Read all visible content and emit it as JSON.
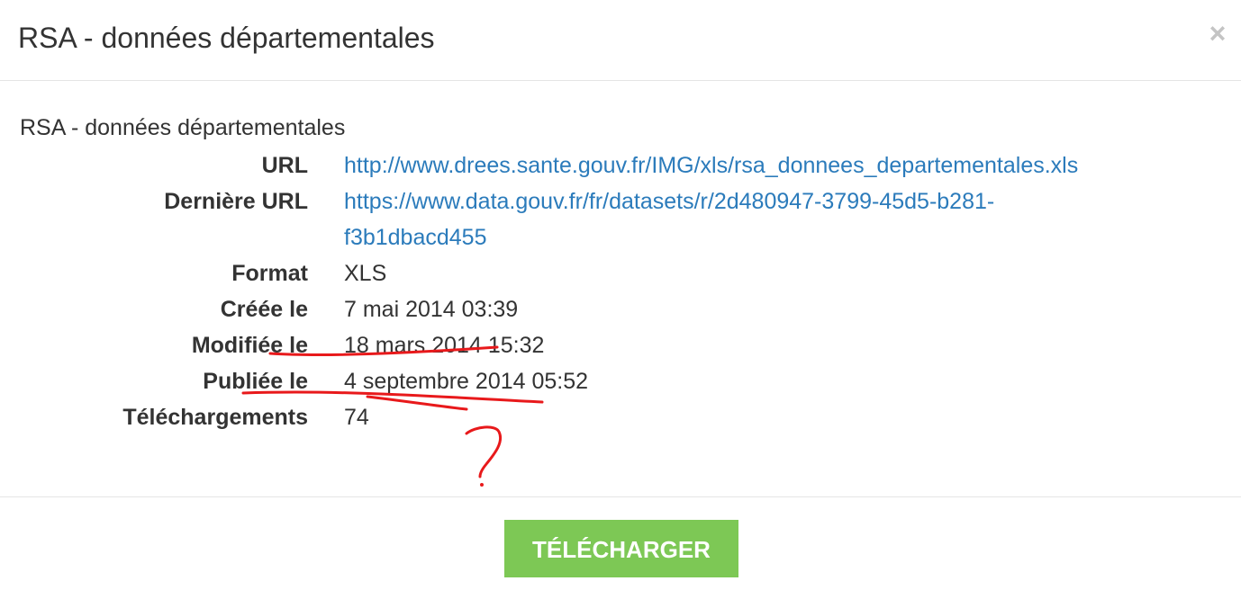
{
  "modal": {
    "title": "RSA - données départementales",
    "close_glyph": "×",
    "close_icon": "close-icon"
  },
  "resource": {
    "name": "RSA - données départementales",
    "details": [
      {
        "label": "URL",
        "value": "http://www.drees.sante.gouv.fr/IMG/xls/rsa_donnees_departementales.xls",
        "is_link": true
      },
      {
        "label": "Dernière URL",
        "value": "https://www.data.gouv.fr/fr/datasets/r/2d480947-3799-45d5-b281-f3b1dbacd455",
        "value_line1": "https://www.data.gouv.fr/fr/datasets/r/2d480947-3799-45d5-b281-",
        "value_line2": "f3b1dbacd455",
        "is_link": true
      },
      {
        "label": "Format",
        "value": "XLS"
      },
      {
        "label": "Créée le",
        "value": "7 mai 2014 03:39"
      },
      {
        "label": "Modifiée le",
        "value": "18 mars 2014 15:32"
      },
      {
        "label": "Publiée le",
        "value": "4 septembre 2014 05:52"
      },
      {
        "label": "Téléchargements",
        "value": "74"
      }
    ]
  },
  "footer": {
    "download_label": "TÉLÉCHARGER"
  },
  "colors": {
    "link": "#2b7bbb",
    "button": "#7dc855",
    "annotation": "#e8191b"
  },
  "annotation": {
    "mark": "?"
  }
}
